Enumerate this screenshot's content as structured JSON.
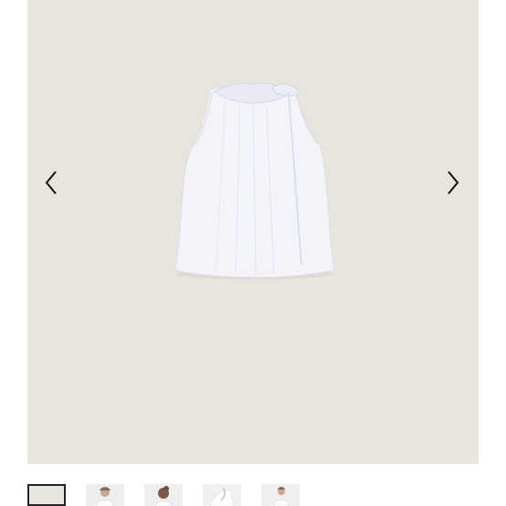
{
  "gallery": {
    "background_color": "#e8e5dc",
    "main_image_icon": "sleeveless-blouse-image",
    "prev_icon": "chevron-left-icon",
    "next_icon": "chevron-right-icon",
    "selected_index": 0,
    "thumbnails": [
      {
        "icon": "blouse-flat-thumbnail",
        "selected": true
      },
      {
        "icon": "model-front-thumbnail",
        "selected": false
      },
      {
        "icon": "model-back-thumbnail",
        "selected": false
      },
      {
        "icon": "detail-thumbnail",
        "selected": false
      },
      {
        "icon": "model-side-thumbnail",
        "selected": false
      }
    ]
  }
}
